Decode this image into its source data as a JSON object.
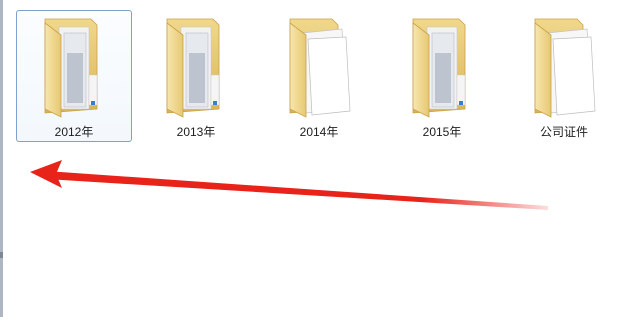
{
  "folders": [
    {
      "label": "2012年",
      "icon": "folder-with-documents-icon",
      "selected": true
    },
    {
      "label": "2013年",
      "icon": "folder-with-documents-icon",
      "selected": false
    },
    {
      "label": "2014年",
      "icon": "folder-with-papers-icon",
      "selected": false
    },
    {
      "label": "2015年",
      "icon": "folder-with-documents-icon",
      "selected": false
    },
    {
      "label": "公司证件",
      "icon": "folder-with-papers-icon",
      "selected": false
    }
  ],
  "annotation": {
    "type": "red-arrow",
    "direction": "left",
    "color": "#e8231a"
  },
  "colors": {
    "folder_back": "#e2c06a",
    "folder_front": "#f3dc92",
    "selection_border": "#7da2ce"
  }
}
